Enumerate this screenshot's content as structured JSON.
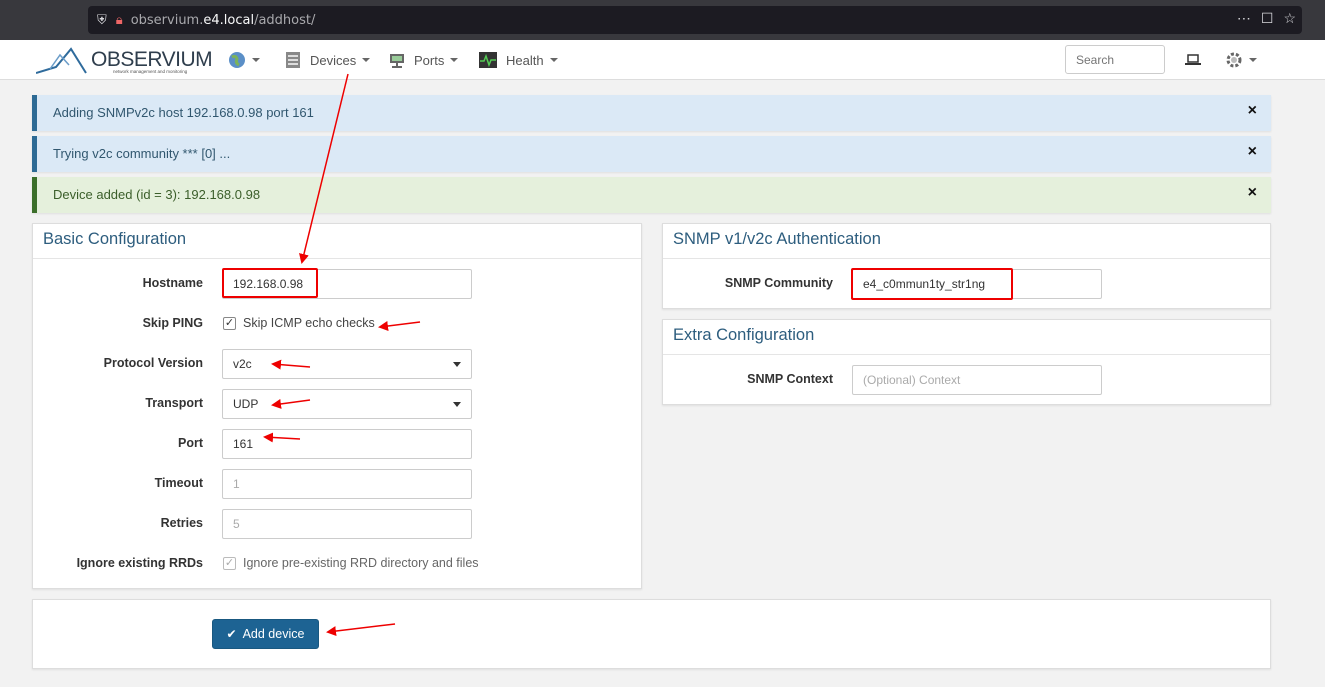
{
  "browser": {
    "url_prefix": "observium.",
    "url_domain": "e4.local",
    "url_path": "/addhost/"
  },
  "navbar": {
    "logo_text": "OBSERVIUM",
    "logo_subtitle": "network management and monitoring",
    "devices_label": "Devices",
    "ports_label": "Ports",
    "health_label": "Health",
    "search_placeholder": "Search"
  },
  "alerts": [
    {
      "text": "Adding SNMPv2c host 192.168.0.98 port 161",
      "close": "×"
    },
    {
      "text": "Trying v2c community *** [0] ...",
      "close": "×"
    },
    {
      "text": "Device added (id = 3): 192.168.0.98",
      "close": "×"
    }
  ],
  "basic_config": {
    "title": "Basic Configuration",
    "hostname": {
      "label": "Hostname",
      "value": "192.168.0.98"
    },
    "skip_ping": {
      "label": "Skip PING",
      "checkbox_label": "Skip ICMP echo checks",
      "checked": true
    },
    "protocol_version": {
      "label": "Protocol Version",
      "value": "v2c"
    },
    "transport": {
      "label": "Transport",
      "value": "UDP"
    },
    "port": {
      "label": "Port",
      "value": "161"
    },
    "timeout": {
      "label": "Timeout",
      "placeholder": "1"
    },
    "retries": {
      "label": "Retries",
      "placeholder": "5"
    },
    "ignore_rrd": {
      "label": "Ignore existing RRDs",
      "checkbox_label": "Ignore pre-existing RRD directory and files",
      "checked": true
    }
  },
  "snmp_auth": {
    "title": "SNMP v1/v2c Authentication",
    "community": {
      "label": "SNMP Community",
      "value": "e4_c0mmun1ty_str1ng"
    }
  },
  "extra_config": {
    "title": "Extra Configuration",
    "context": {
      "label": "SNMP Context",
      "placeholder": "(Optional) Context"
    }
  },
  "actions": {
    "add_device_label": "Add device"
  },
  "colors": {
    "annotation": "#e00000",
    "primary_button": "#1d6393",
    "info_alert": "#dbe9f6",
    "success_alert": "#e5f0dc"
  }
}
